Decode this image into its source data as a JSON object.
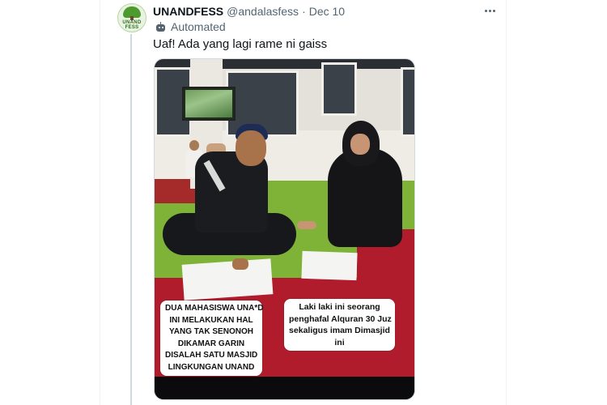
{
  "tweet": {
    "author_name": "UNANDFESS",
    "handle": "@andalasfess",
    "separator": "·",
    "date": "Dec 10",
    "automated_label": "Automated",
    "text": "Uaf! Ada yang lagi rame ni gaiss",
    "avatar_text": "UNAND FESS"
  },
  "media": {
    "caption_left_lines": [
      "DUA MAHASISWA UNA*D",
      "INI MELAKUKAN HAL",
      "YANG TAK SENONOH",
      "DIKAMAR GARIN",
      "DISALAH SATU MASJID",
      "LINGKUNGAN UNAND"
    ],
    "caption_right_lines": [
      "Laki laki ini seorang",
      "penghafal Alquran 30 Juz",
      "sekaligus imam Dimasjid",
      "ini"
    ]
  },
  "icons": {
    "more": "more-horizontal-icon",
    "automated": "bot-icon"
  },
  "colors": {
    "text_primary": "#0f1419",
    "text_secondary": "#536471",
    "border": "#eff3f4",
    "thread_line": "#cfd9de"
  }
}
